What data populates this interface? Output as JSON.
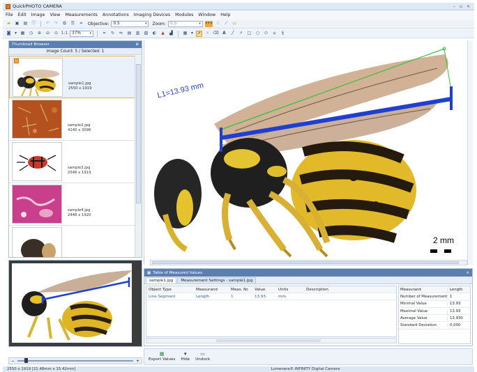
{
  "window": {
    "title": "QuickPHOTO CAMERA",
    "controls": [
      "–",
      "▫",
      "×"
    ]
  },
  "menu": [
    "File",
    "Edit",
    "Image",
    "View",
    "Measurements",
    "Annotations",
    "Imaging Devices",
    "Modules",
    "Window",
    "Help"
  ],
  "toolbar1": {
    "objective_label": "Objective:",
    "objective_value": "0.5",
    "zoom_label": "Zoom:",
    "zoom_value": "0.5"
  },
  "toolbar2": {
    "zoom_percent": "37%"
  },
  "thumbnail_browser": {
    "title": "Thumbnail Browser",
    "count_text": "Image Count: 5 / Selected: 1",
    "items": [
      {
        "name": "sample1.jpg",
        "size": "2550 x 1919",
        "selected": true
      },
      {
        "name": "sample2.jpg",
        "size": "4140 x 3096",
        "selected": false
      },
      {
        "name": "sample3.jpg",
        "size": "2546 x 1919",
        "selected": false
      },
      {
        "name": "sample4.jpg",
        "size": "2448 x 1920",
        "selected": false
      },
      {
        "name": "",
        "size": "",
        "selected": false
      }
    ]
  },
  "image_view": {
    "measurement_label": "L1=13.93 mm",
    "scale_bar_label": "2 mm"
  },
  "measured_values": {
    "title": "Table of Measured Values",
    "tabs": [
      "sample1.jpg",
      "Measurement Settings - sample1.jpg"
    ],
    "columns": [
      "Object Type",
      "Measurand",
      "Meas. Nr.",
      "Value",
      "Units",
      "Description"
    ],
    "rows": [
      [
        "Line Segment",
        "Length",
        "1",
        "13.93",
        "mm",
        ""
      ]
    ],
    "stats_header": [
      "Measurand",
      "Length"
    ],
    "stats": [
      [
        "Number of Measurements",
        "1"
      ],
      [
        "Minimal Value",
        "13.93"
      ],
      [
        "Maximal Value",
        "13.93"
      ],
      [
        "Average Value",
        "13.930"
      ],
      [
        "Standard Deviation",
        "0.000"
      ]
    ]
  },
  "bottom_tools": [
    "Export Values",
    "Hide",
    "Undock"
  ],
  "status": {
    "left": "2550 x 1919 [21.48mm x 15.42mm]",
    "right": "Lumenera® INFINITY Digital Camera"
  },
  "colors": {
    "measure_line": "#1f3fd0",
    "guide_line": "#35c23a",
    "header": "#5b7fb1"
  }
}
